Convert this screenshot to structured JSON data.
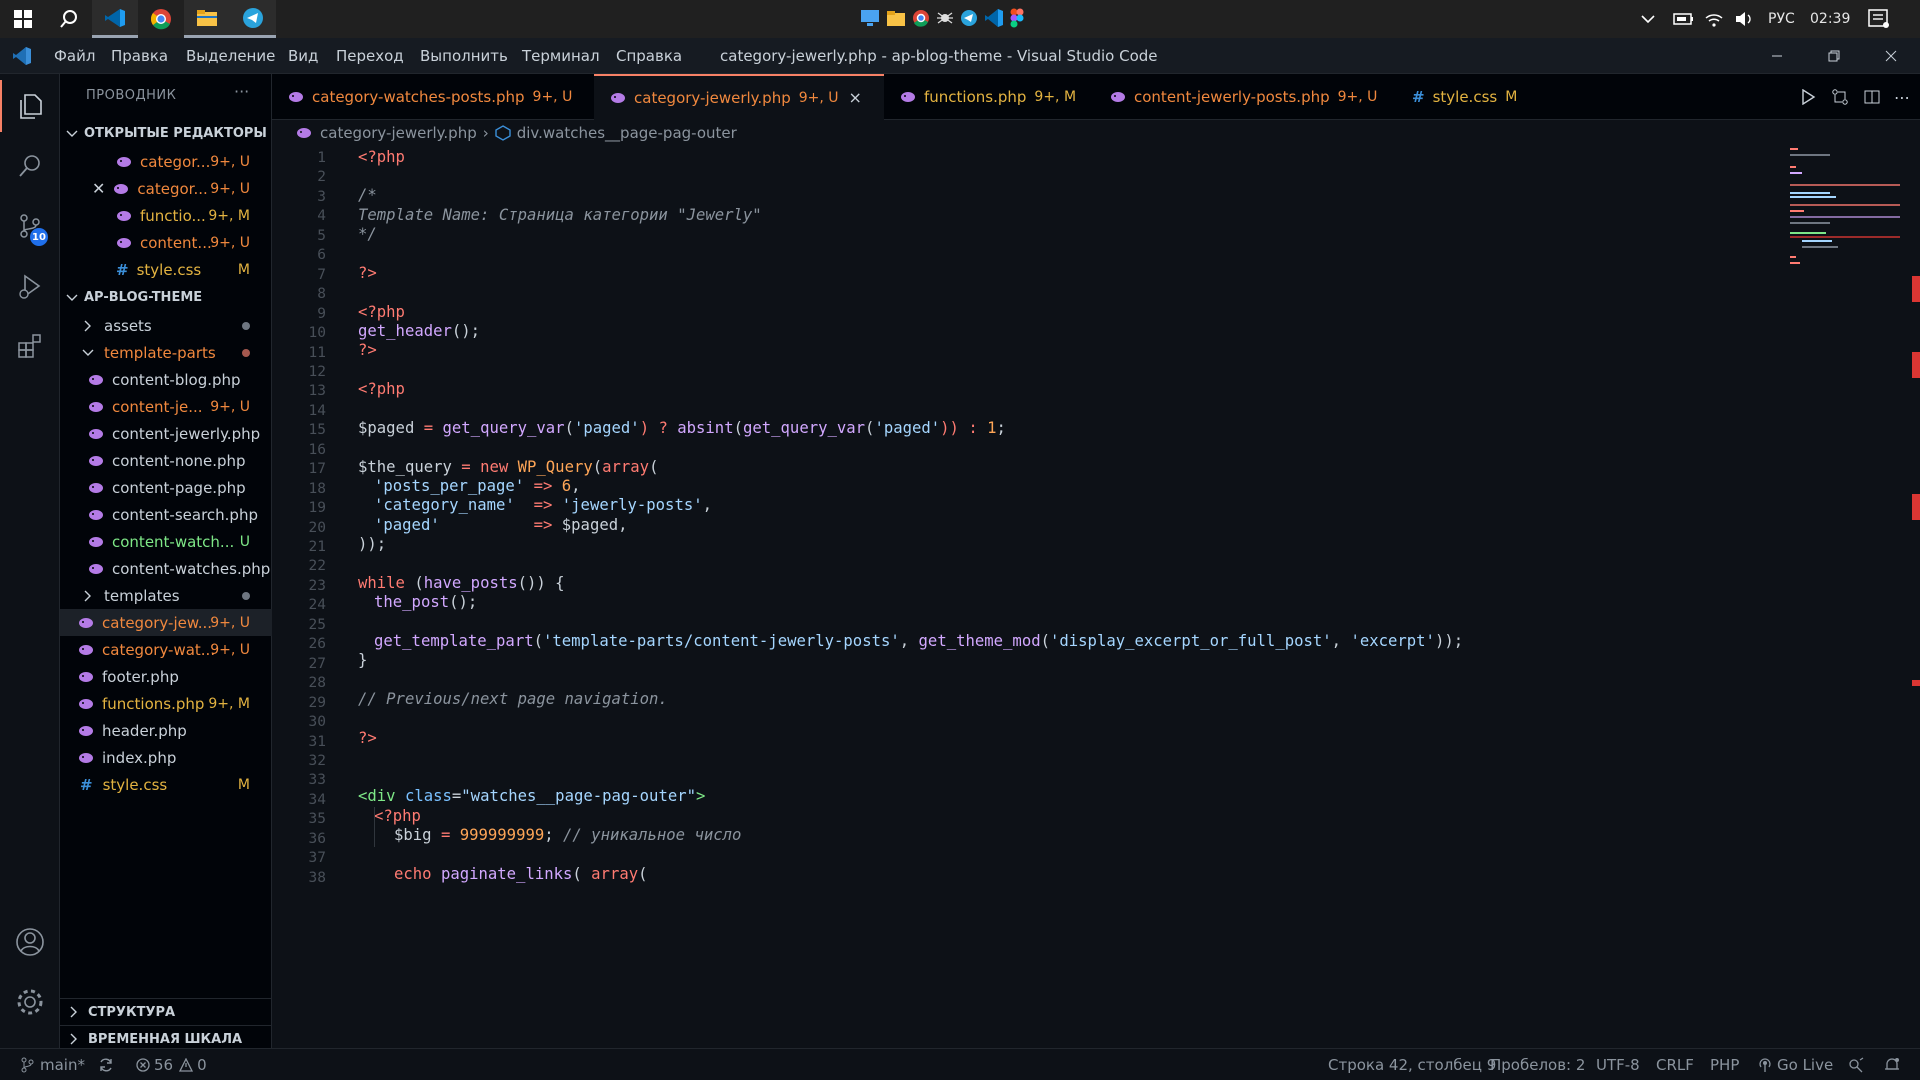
{
  "colors": {
    "modified": "#e3b341",
    "untracked": "#f0883e",
    "error": "#da3633",
    "accent": "#f78166",
    "php_icon": "#b47be6"
  },
  "taskbar": {
    "lang": "РУС",
    "time": "02:39"
  },
  "titlebar": {
    "menu": [
      "Файл",
      "Правка",
      "Выделение",
      "Вид",
      "Переход",
      "Выполнить",
      "Терминал",
      "Справка"
    ],
    "title": "category-jewerly.php - ap-blog-theme - Visual Studio Code"
  },
  "activity": {
    "scm_badge": "10"
  },
  "sidebar": {
    "title": "ПРОВОДНИК",
    "more": "···",
    "open_editors_label": "ОТКРЫТЫЕ РЕДАКТОРЫ",
    "open_editors": [
      {
        "name": "categor...",
        "status": "9+, U"
      },
      {
        "name": "categor...",
        "status": "9+, U"
      },
      {
        "name": "functio...",
        "status": "9+, M"
      },
      {
        "name": "content...",
        "status": "9+, U"
      },
      {
        "name": "style.css",
        "status": "M"
      }
    ],
    "project_label": "AP-BLOG-THEME",
    "tree": [
      {
        "name": "assets"
      },
      {
        "name": "template-parts"
      },
      {
        "name": "content-blog.php"
      },
      {
        "name": "content-je...",
        "status": "9+, U"
      },
      {
        "name": "content-jewerly.php"
      },
      {
        "name": "content-none.php"
      },
      {
        "name": "content-page.php"
      },
      {
        "name": "content-search.php"
      },
      {
        "name": "content-watch...",
        "status": "U"
      },
      {
        "name": "content-watches.php"
      },
      {
        "name": "templates"
      },
      {
        "name": "category-jew...",
        "status": "9+, U"
      },
      {
        "name": "category-wat...",
        "status": "9+, U"
      },
      {
        "name": "footer.php"
      },
      {
        "name": "functions.php",
        "status": "9+, M"
      },
      {
        "name": "header.php"
      },
      {
        "name": "index.php"
      },
      {
        "name": "style.css",
        "status": "M"
      }
    ],
    "outline_label": "СТРУКТУРА",
    "timeline_label": "ВРЕМЕННАЯ ШКАЛА"
  },
  "tabs": [
    {
      "label": "category-watches-posts.php",
      "status": "9+, U"
    },
    {
      "label": "category-jewerly.php",
      "status": "9+, U",
      "close": "×"
    },
    {
      "label": "functions.php",
      "status": "9+, M"
    },
    {
      "label": "content-jewerly-posts.php",
      "status": "9+, U"
    },
    {
      "label": "style.css",
      "status": "M"
    }
  ],
  "breadcrumb": {
    "file": "category-jewerly.php",
    "sep": "›",
    "symbol": "div.watches__page-pag-outer"
  },
  "editor": {
    "line_numbers": [
      "1",
      "2",
      "3",
      "4",
      "5",
      "6",
      "7",
      "8",
      "9",
      "10",
      "11",
      "12",
      "13",
      "14",
      "15",
      "16",
      "17",
      "18",
      "19",
      "20",
      "21",
      "22",
      "23",
      "24",
      "25",
      "26",
      "27",
      "28",
      "29",
      "30",
      "31",
      "32",
      "33",
      "34",
      "35",
      "36",
      "37",
      "38"
    ],
    "code": {
      "l1": "<?php",
      "l3": "/*",
      "l4": "Template Name: Страница категории \"Jewerly\"",
      "l5": "*/",
      "l7": "?>",
      "l9": "<?php",
      "l10a": "get_header",
      "l10b": "();",
      "l11": "?>",
      "l13": "<?php",
      "l15": {
        "var": "$paged",
        "eq": " = ",
        "fn1": "get_query_var",
        "s1": "'paged'",
        "q": ") ? ",
        "fn2": "absint",
        "fn3": "get_query_var",
        "s2": "'paged'",
        "end": ")) : ",
        "num": "1",
        "semi": ";"
      },
      "l17": {
        "var": "$the_query",
        "eq": " = ",
        "new": "new ",
        "cls": "WP_Query",
        "arr": "array",
        "open": "("
      },
      "l18": {
        "key": "'posts_per_page'",
        "arrow": " => ",
        "val": "6",
        "comma": ","
      },
      "l19": {
        "key": "'category_name'",
        "arrow": "  => ",
        "val": "'jewerly-posts'",
        "comma": ","
      },
      "l20": {
        "key": "'paged'",
        "arrow": "          => ",
        "val": "$paged",
        "comma": ","
      },
      "l21": "));",
      "l23": {
        "kw": "while",
        "open": " (",
        "fn": "have_posts",
        "end": "()) {"
      },
      "l24": {
        "fn": "the_post",
        "end": "();"
      },
      "l26": {
        "fn": "get_template_part",
        "s1": "'template-parts/content-jewerly-posts'",
        "comma": ", ",
        "fn2": "get_theme_mod",
        "s2": "'display_excerpt_or_full_post'",
        "s3": "'excerpt'",
        "end": "));"
      },
      "l27": "}",
      "l29": "// Previous/next page navigation.",
      "l31": "?>",
      "l34": {
        "tag": "<div",
        "attr": " class",
        "eq": "=",
        "val": "\"watches__page-pag-outer\"",
        "close": ">"
      },
      "l35": "<?php",
      "l36": {
        "var": "$big",
        "eq": " = ",
        "num": "999999999",
        "semi": ";",
        "comment": " // уникальное число"
      },
      "l38": {
        "kw": "echo",
        "fn": " paginate_links",
        "open": "( ",
        "arr": "array",
        "paren": "("
      }
    }
  },
  "status": {
    "branch": "main*",
    "errors": "56",
    "warnings": "0",
    "position": "Строка 42, столбец 9",
    "spaces": "Пробелов: 2",
    "encoding": "UTF-8",
    "eol": "CRLF",
    "language": "PHP",
    "golive": "Go Live"
  }
}
